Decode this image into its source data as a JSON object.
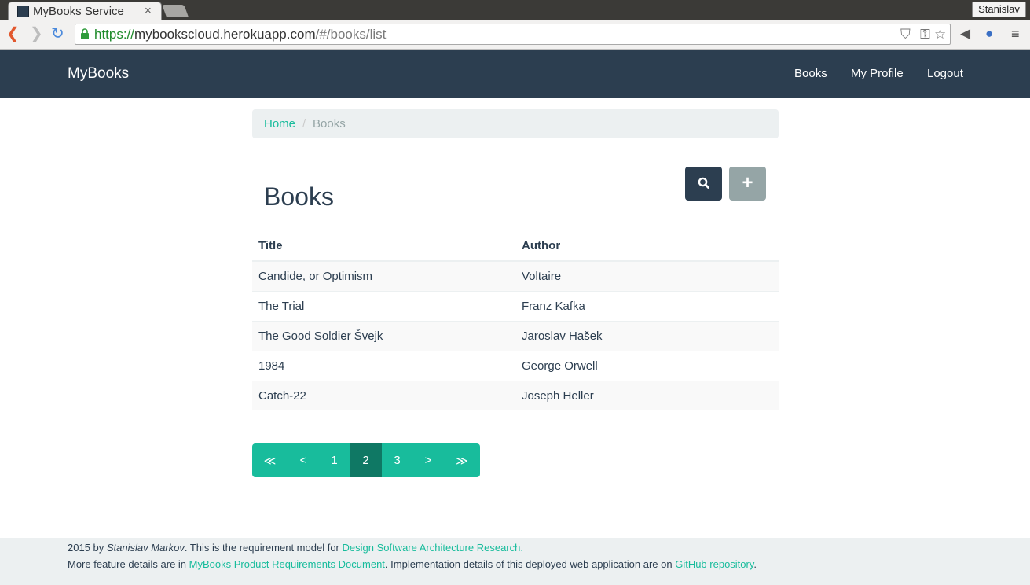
{
  "browser": {
    "tab_title": "MyBooks Service",
    "tab_close": "×",
    "profile": "Stanislav",
    "url_scheme": "https://",
    "url_host": "mybookscloud.herokuapp.com",
    "url_path": "/#/books/list"
  },
  "navbar": {
    "brand": "MyBooks",
    "links": [
      "Books",
      "My Profile",
      "Logout"
    ]
  },
  "breadcrumb": {
    "home": "Home",
    "separator": "/",
    "current": "Books"
  },
  "page": {
    "title": "Books"
  },
  "table": {
    "headers": [
      "Title",
      "Author"
    ],
    "rows": [
      [
        "Candide, or Optimism",
        "Voltaire"
      ],
      [
        "The Trial",
        "Franz Kafka"
      ],
      [
        "The Good Soldier Švejk",
        "Jaroslav Hašek"
      ],
      [
        "1984",
        "George Orwell"
      ],
      [
        "Catch-22",
        "Joseph Heller"
      ]
    ]
  },
  "pagination": {
    "items": [
      "≪",
      "<",
      "1",
      "2",
      "3",
      ">",
      "≫"
    ],
    "active": "2"
  },
  "footer": {
    "line1_year": "2015 by ",
    "line1_author": "Stanislav Markov",
    "line1_text": ". This is the requirement model for ",
    "line1_link": "Design Software Architecture Research.",
    "line2_text_a": "More feature details are in ",
    "line2_link_a": "MyBooks Product Requirements Document",
    "line2_text_b": ". Implementation details of this deployed web application are on ",
    "line2_link_b": "GitHub repository",
    "line2_text_c": "."
  },
  "colors": {
    "navbar": "#2c3e50",
    "accent": "#18bc9c",
    "active_page": "#0f7864",
    "secondary_button": "#95a5a6"
  },
  "icons": {
    "search_button": "search-icon",
    "add_button": "plus-icon"
  }
}
